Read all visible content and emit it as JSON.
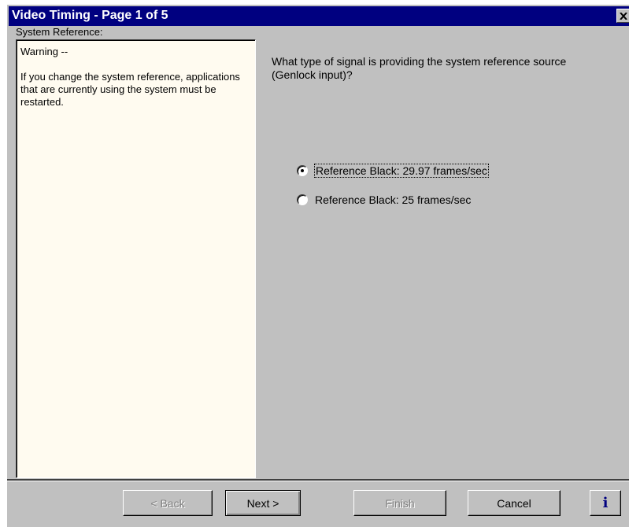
{
  "window": {
    "title": "Video Timing - Page 1 of 5"
  },
  "section_label": "System Reference:",
  "warning": {
    "heading": "Warning --",
    "body": "If you change the system reference, applications that are currently using the system must be restarted."
  },
  "question": "What type of signal is providing the system reference source (Genlock input)?",
  "options": [
    {
      "label": "Reference Black: 29.97 frames/sec",
      "selected": true
    },
    {
      "label": "Reference Black: 25 frames/sec",
      "selected": false
    }
  ],
  "buttons": {
    "back": "< Back",
    "next": "Next >",
    "finish": "Finish",
    "cancel": "Cancel",
    "info": "i"
  },
  "icons": {
    "close": "close-icon",
    "info": "info-icon"
  },
  "colors": {
    "titlebar": "#000080",
    "dialog": "#c0c0c0",
    "panel": "#fffbf0"
  }
}
